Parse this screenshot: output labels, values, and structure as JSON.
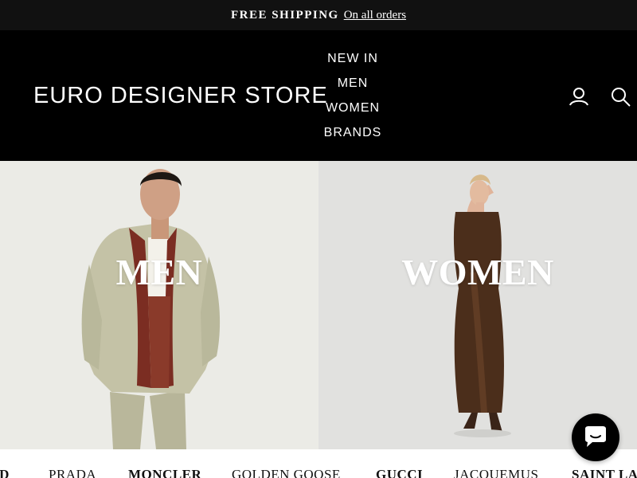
{
  "announcement": {
    "bold_text": "FREE SHIPPING",
    "link_text": "On all orders"
  },
  "header": {
    "logo": "EURO DESIGNER STORE",
    "nav": [
      "NEW IN",
      "MEN",
      "WOMEN",
      "BRANDS"
    ],
    "icons": [
      "account-icon",
      "search-icon"
    ]
  },
  "hero": {
    "men_label": "MEN",
    "women_label": "WOMEN"
  },
  "brands": [
    "ID",
    "PRADA",
    "MONCLER",
    "GOLDEN GOOSE",
    "GUCCI",
    "JACQUEMUS",
    "SAINT LAU"
  ],
  "chat": {
    "icon": "chat-icon"
  },
  "colors": {
    "announcement_bg": "#111111",
    "header_bg": "#000000",
    "text_light": "#ffffff"
  }
}
